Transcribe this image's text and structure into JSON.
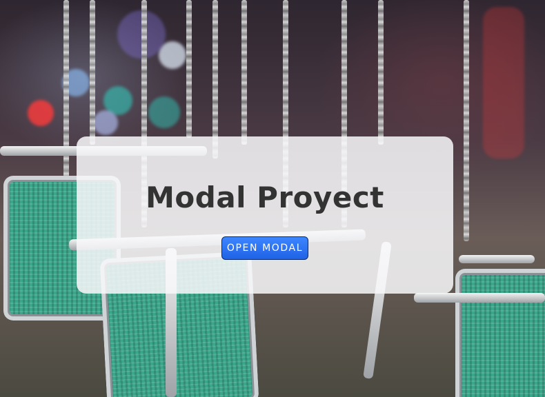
{
  "page": {
    "title": "Modal Proyect",
    "button_label": "OPEN MODAL"
  },
  "colors": {
    "panel_background": "#f8f8fa",
    "title_text": "#333333",
    "button_background": "#2a6ff2",
    "button_text": "#ffffff",
    "seat_green": "#3aa68a"
  }
}
